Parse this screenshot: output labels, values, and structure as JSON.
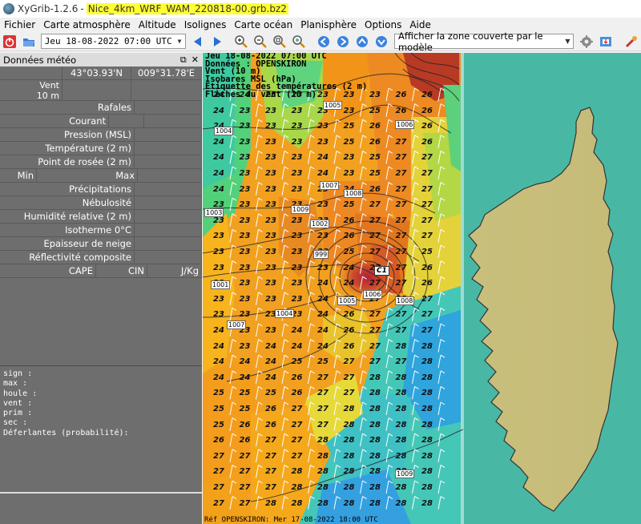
{
  "window": {
    "app_name": "XyGrib-1.2.6",
    "separator": "-",
    "file_name": "Nice_4km_WRF_WAM_220818-00.grb.bz2"
  },
  "menu": [
    "Fichier",
    "Carte atmosphère",
    "Altitude",
    "Isolignes",
    "Carte océan",
    "Planisphère",
    "Options",
    "Aide"
  ],
  "toolbar": {
    "date": "Jeu 18-08-2022 07:00 UTC",
    "zone_option": "Afficher la zone couverte par le modèle"
  },
  "panel": {
    "title": "Données météo",
    "coords": {
      "lat": "43°03.93'N",
      "lon": "009°31.78'E"
    },
    "vent_label": "Vent",
    "vent_height": "10 m",
    "rows": [
      "Rafales",
      "Courant",
      "Pression (MSL)",
      "Température (2 m)",
      "Point de rosée (2 m)"
    ],
    "min_label": "Min",
    "max_label": "Max",
    "rows2": [
      "Précipitations",
      "Nébulosité",
      "Humidité relative (2 m)",
      "Isotherme 0°C",
      "Epaisseur de neige",
      "Réflectivité composite"
    ],
    "cape_label": "CAPE",
    "cin_label": "CIN",
    "cape_unit": "J/Kg",
    "info_lines": [
      "sign :",
      "max :",
      "houle :",
      "vent :",
      "prim :",
      "sec :",
      "Déferlantes (probabilité):"
    ]
  },
  "map": {
    "header": [
      "Jeu 18-08-2022 07:00 UTC",
      "Données : OPENSKIRON",
      "Vent (10 m)",
      "Isobares MSL (hPa)",
      "Etiquette des températures (2 m)",
      "Flèches du vent (10 m)"
    ],
    "footer": "Réf OPENSKIRON: Mer 17-08-2022 18:00 UTC",
    "low_marker": "C1",
    "isobar_labels": [
      "1004",
      "1005",
      "1006",
      "1007",
      "1008",
      "1009",
      "1003",
      "1002",
      "999",
      "1001"
    ],
    "temp_grid": [
      [
        "24",
        "24",
        "23",
        "23",
        "23",
        "23",
        "23",
        "26",
        "26"
      ],
      [
        "24",
        "23",
        "23",
        "23",
        "23",
        "23",
        "25",
        "26",
        "26"
      ],
      [
        "24",
        "23",
        "23",
        "23",
        "23",
        "25",
        "26",
        "26",
        "26"
      ],
      [
        "24",
        "23",
        "23",
        "23",
        "23",
        "25",
        "26",
        "27",
        "26"
      ],
      [
        "24",
        "23",
        "23",
        "23",
        "24",
        "23",
        "25",
        "27",
        "27"
      ],
      [
        "24",
        "23",
        "23",
        "23",
        "24",
        "23",
        "25",
        "27",
        "27"
      ],
      [
        "24",
        "23",
        "23",
        "23",
        "23",
        "24",
        "26",
        "27",
        "27"
      ],
      [
        "23",
        "23",
        "23",
        "23",
        "23",
        "25",
        "27",
        "27",
        "27"
      ],
      [
        "23",
        "23",
        "23",
        "23",
        "23",
        "26",
        "27",
        "27",
        "27"
      ],
      [
        "23",
        "23",
        "23",
        "23",
        "23",
        "26",
        "27",
        "27",
        "27"
      ],
      [
        "23",
        "23",
        "23",
        "23",
        "23",
        "25",
        "27",
        "27",
        "25"
      ],
      [
        "23",
        "23",
        "23",
        "23",
        "23",
        "24",
        "27",
        "27",
        "26"
      ],
      [
        "23",
        "23",
        "23",
        "23",
        "24",
        "24",
        "27",
        "27",
        "26"
      ],
      [
        "23",
        "23",
        "23",
        "23",
        "24",
        "25",
        "27",
        "28",
        "27"
      ],
      [
        "23",
        "23",
        "23",
        "23",
        "24",
        "26",
        "27",
        "27",
        "27"
      ],
      [
        "24",
        "23",
        "23",
        "24",
        "24",
        "26",
        "27",
        "27",
        "27"
      ],
      [
        "24",
        "23",
        "24",
        "24",
        "24",
        "26",
        "27",
        "28",
        "28"
      ],
      [
        "24",
        "24",
        "24",
        "25",
        "25",
        "27",
        "27",
        "27",
        "28"
      ],
      [
        "24",
        "24",
        "24",
        "26",
        "27",
        "27",
        "28",
        "28",
        "28"
      ],
      [
        "25",
        "25",
        "25",
        "26",
        "27",
        "27",
        "28",
        "28",
        "28"
      ],
      [
        "25",
        "25",
        "26",
        "27",
        "27",
        "28",
        "28",
        "28",
        "28"
      ],
      [
        "25",
        "26",
        "26",
        "27",
        "27",
        "28",
        "28",
        "28",
        "28"
      ],
      [
        "26",
        "26",
        "27",
        "27",
        "28",
        "28",
        "28",
        "28",
        "28"
      ],
      [
        "27",
        "27",
        "27",
        "27",
        "28",
        "28",
        "28",
        "28",
        "28"
      ],
      [
        "27",
        "27",
        "27",
        "28",
        "28",
        "28",
        "28",
        "28",
        "28"
      ],
      [
        "27",
        "27",
        "27",
        "28",
        "28",
        "28",
        "28",
        "28",
        "28"
      ],
      [
        "27",
        "27",
        "28",
        "28",
        "28",
        "28",
        "28",
        "28",
        "28"
      ]
    ]
  }
}
